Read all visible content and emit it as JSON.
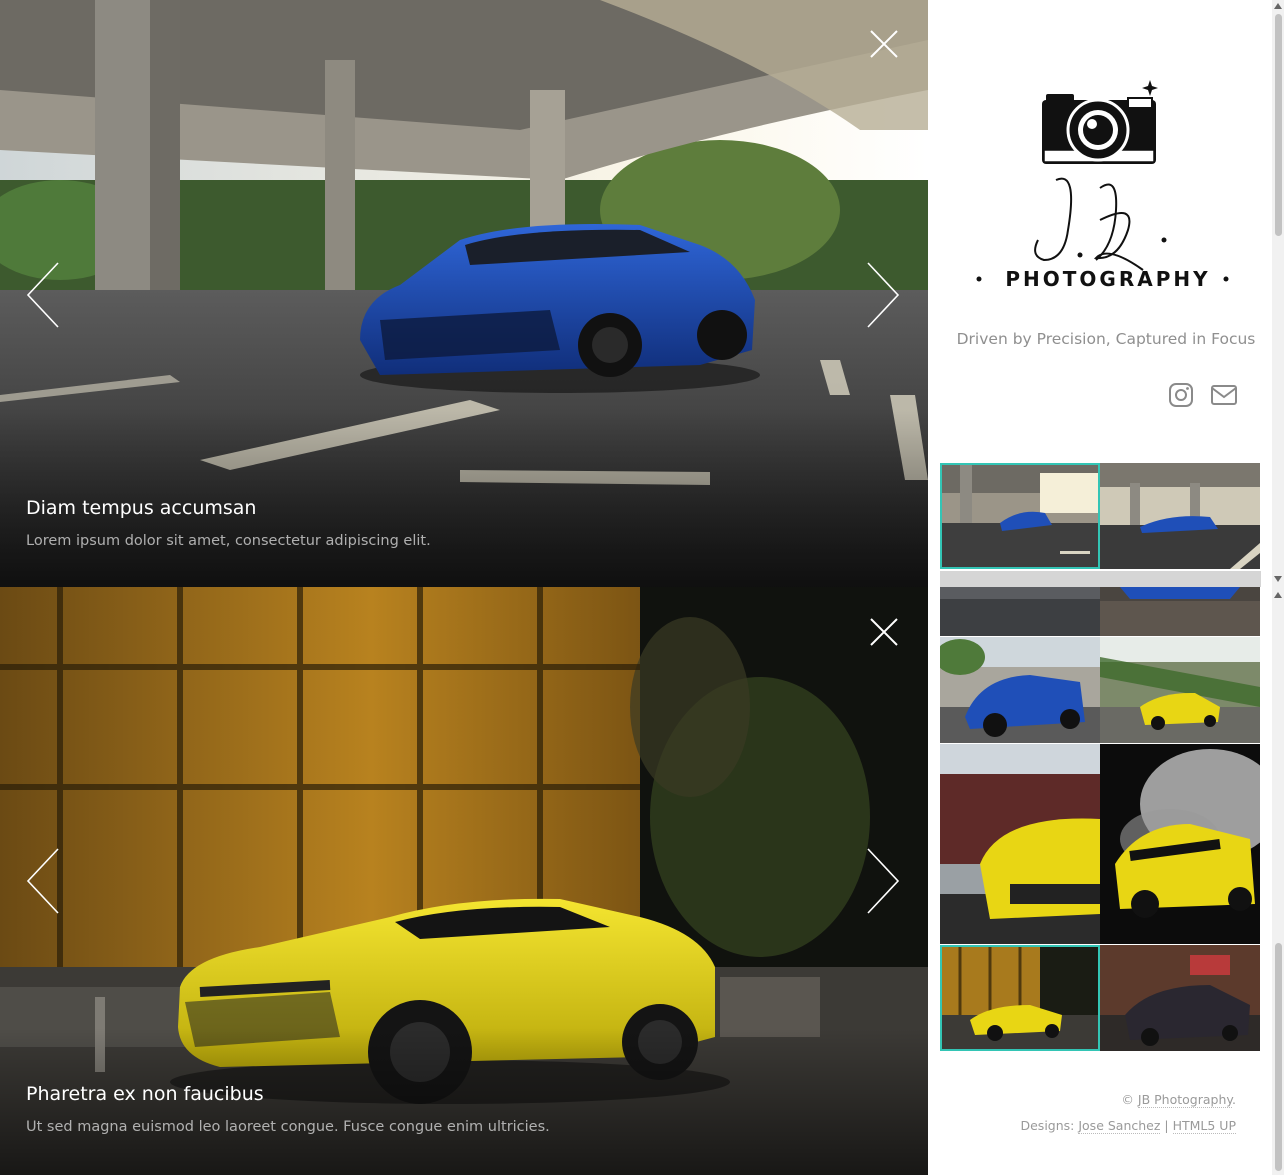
{
  "panes": [
    {
      "slide": {
        "title": "Diam tempus accumsan",
        "description": "Lorem ipsum dolor sit amet, consectetur adipiscing elit.",
        "image": "blue-camaro-under-overpass"
      }
    },
    {
      "slide": {
        "title": "Pharetra ex non faucibus",
        "description": "Ut sed magna euismod leo laoreet congue. Fusce congue enim ultricies.",
        "image": "yellow-camaro-night-building"
      }
    }
  ],
  "controls": {
    "close_icon": "close-icon",
    "prev_icon": "chevron-left-icon",
    "next_icon": "chevron-right-icon"
  },
  "brand": {
    "logo_script": "J.B.",
    "logo_word": "PHOTOGRAPHY",
    "logo_icon": "camera-icon",
    "tagline": "Driven by Precision, Captured in Focus"
  },
  "social": [
    {
      "name": "instagram-icon"
    },
    {
      "name": "mail-icon"
    }
  ],
  "thumbnails": [
    {
      "image": "blue-camaro-overpass",
      "active": true
    },
    {
      "image": "blue-camaro-overpass-wide",
      "active": false
    },
    {
      "image": "dark-road-blur",
      "active": false
    },
    {
      "image": "blue-car-detail",
      "active": false
    },
    {
      "image": "blue-camaro-street",
      "active": false
    },
    {
      "image": "yellow-camaro-road",
      "active": false
    },
    {
      "image": "yellow-camaro-train",
      "active": false
    },
    {
      "image": "yellow-camaro-smoke",
      "active": false
    },
    {
      "image": "yellow-camaro-building",
      "active": true
    },
    {
      "image": "dark-camaro-brick",
      "active": false
    }
  ],
  "footer": {
    "copyright_prefix": "© ",
    "copyright_link": "JB Photography",
    "copyright_suffix": ".",
    "designs_prefix": "Designs: ",
    "designer_link": "Jose Sanchez",
    "separator": " | ",
    "template_link": "HTML5 UP"
  },
  "colors": {
    "accent": "#33c5b5",
    "blue_car": "#1f4fb8",
    "yellow_car": "#e8d614"
  }
}
